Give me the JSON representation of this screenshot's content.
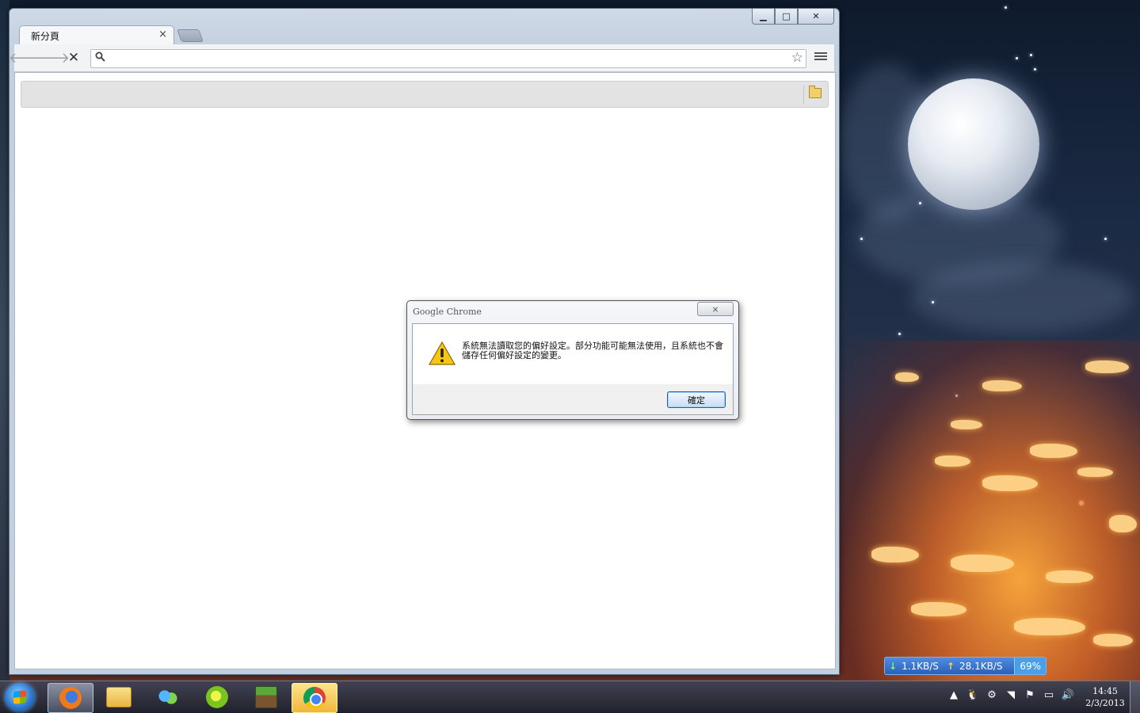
{
  "browser": {
    "tab_title": "新分頁",
    "tab_close_glyph": "×",
    "window_min_glyph": "▁",
    "window_max_glyph": "□",
    "window_close_glyph": "✕",
    "back_glyph": "🡐",
    "forward_glyph": "🡒",
    "stop_glyph": "✕",
    "omnibox_value": "",
    "star_glyph": "☆"
  },
  "dialog": {
    "title": "Google Chrome",
    "close_glyph": "⨯",
    "message": "系統無法讀取您的偏好設定。部分功能可能無法使用，且系統也不會儲存任何偏好設定的變更。",
    "ok_label": "確定"
  },
  "net_widget": {
    "download": "1.1KB/S",
    "upload": "28.1KB/S",
    "usage": "69%"
  },
  "taskbar": {
    "items": [
      "firefox-icon",
      "explorer-icon",
      "messenger-icon",
      "green-app-icon",
      "minecraft-icon",
      "chrome-icon"
    ],
    "tray_glyphs": [
      "▲",
      "🐧",
      "⚙",
      "◥",
      "⚑",
      "▭",
      "🔊"
    ],
    "clock_time": "14:45",
    "clock_date": "2/3/2013"
  },
  "colors": {
    "accent_blue": "#2b5fb8",
    "active_task": "#f0b63c",
    "warning_yellow": "#f6c516"
  }
}
